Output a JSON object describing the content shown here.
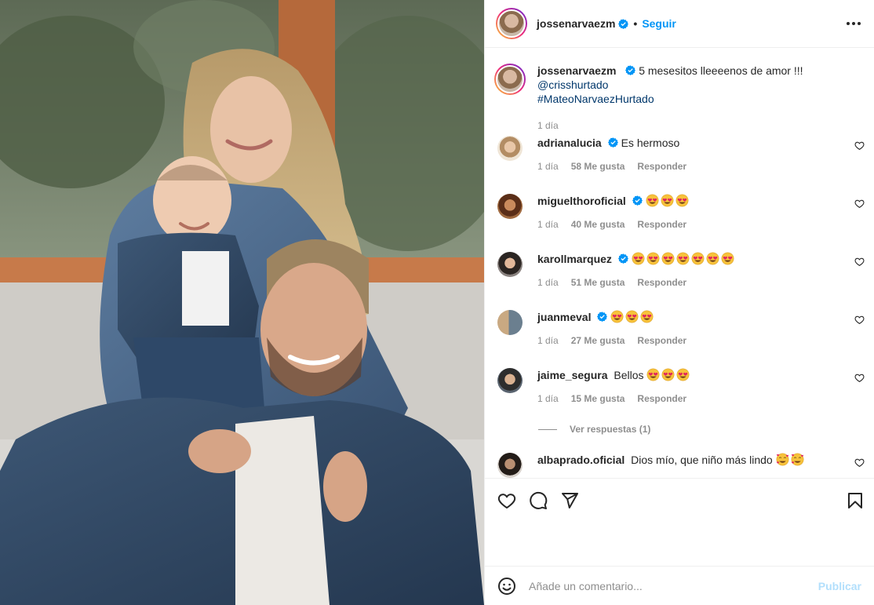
{
  "post": {
    "author": "jossenarvaezm",
    "follow_label": "Seguir",
    "separator": "•",
    "caption_text": "5 mesesitos lleeeenos de amor !!!",
    "caption_mention": "@crisshurtado",
    "caption_hashtag": "#MateoNarvaezHurtado",
    "caption_time": "1 día"
  },
  "comments": [
    {
      "user": "adrianalucia",
      "verified": true,
      "text": "Es hermoso",
      "emoji_count": 0,
      "time": "1 día",
      "likes": "58 Me gusta",
      "reply": "Responder"
    },
    {
      "user": "miguelthoroficial",
      "verified": true,
      "text": "",
      "emoji_count": 3,
      "time": "1 día",
      "likes": "40 Me gusta",
      "reply": "Responder"
    },
    {
      "user": "karollmarquez",
      "verified": true,
      "text": "",
      "emoji_count": 7,
      "time": "1 día",
      "likes": "51 Me gusta",
      "reply": "Responder"
    },
    {
      "user": "juanmeval",
      "verified": true,
      "text": "",
      "emoji_count": 3,
      "time": "1 día",
      "likes": "27 Me gusta",
      "reply": "Responder"
    },
    {
      "user": "jaime_segura",
      "verified": false,
      "text": "Bellos",
      "emoji_count": 3,
      "time": "1 día",
      "likes": "15 Me gusta",
      "reply": "Responder"
    },
    {
      "user": "albaprado.oficial",
      "verified": false,
      "text": "Dios mío, que niño más lindo",
      "emoji_count": 2,
      "emoji_style": "smiling-hearts"
    }
  ],
  "view_replies": "Ver respuestas (1)",
  "compose": {
    "placeholder": "Añade un comentario...",
    "publish_label": "Publicar"
  },
  "icons": {
    "more": "more-options-icon",
    "like": "heart-icon",
    "comment": "comment-icon",
    "share": "share-icon",
    "save": "bookmark-icon",
    "emoji": "emoji-icon",
    "verified": "verified-badge-icon"
  },
  "colors": {
    "accent": "#0095f6",
    "verified": "#0095f6",
    "publish_disabled": "#b2dffc",
    "muted": "#8e8e8e",
    "link": "#00376b"
  }
}
